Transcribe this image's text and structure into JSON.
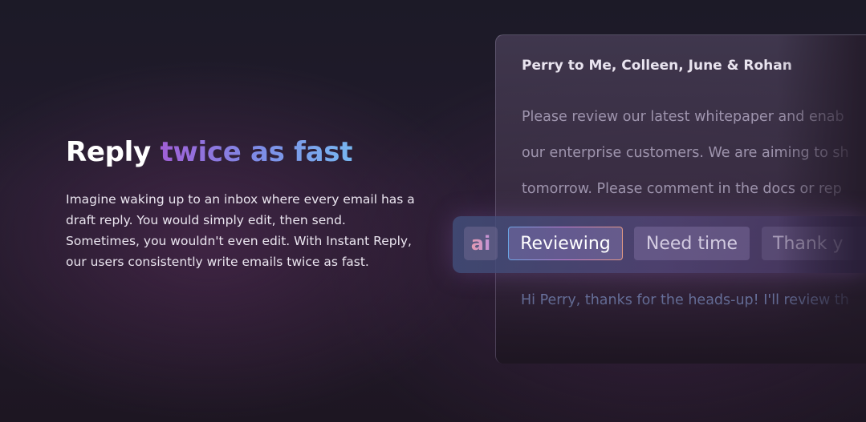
{
  "hero": {
    "headline_plain": "Reply ",
    "headline_accent": "twice as fast",
    "body": "Imagine waking up to an inbox where every email has a draft reply. You would simply edit, then send. Sometimes, you wouldn't even edit.  With Instant Reply, our users consistently write emails twice as fast."
  },
  "email": {
    "from_line": "Perry to Me, Colleen, June & Rohan",
    "body_lines": [
      "Please review our latest whitepaper and enab",
      "our enterprise customers. We are aiming to sh",
      "tomorrow.  Please comment in the docs or rep"
    ],
    "draft_reply": "Hi Perry, thanks for the heads-up!  I'll review th"
  },
  "suggestions": {
    "ai_label": "ai",
    "chips": [
      "Reviewing",
      "Need time",
      "Thank y"
    ]
  }
}
